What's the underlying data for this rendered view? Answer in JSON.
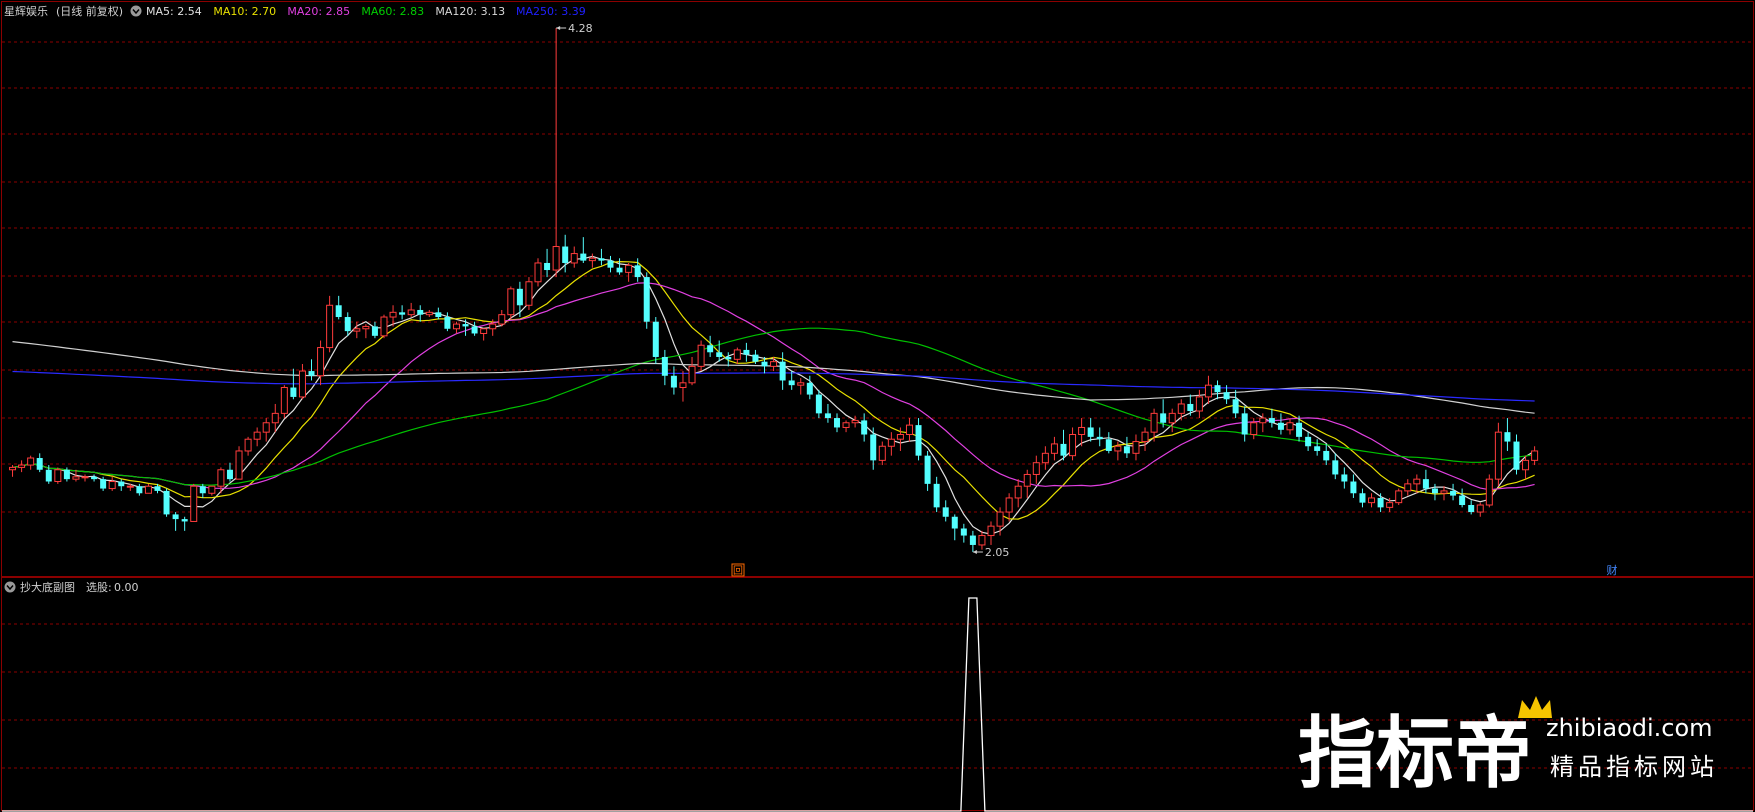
{
  "main_panel": {
    "stock_name": "星辉娱乐",
    "period_label": "(日线 前复权)",
    "ma_legend": [
      {
        "label": "MA5:",
        "value": "2.54",
        "color": "#e0e0e0"
      },
      {
        "label": "MA10:",
        "value": "2.70",
        "color": "#e8e000"
      },
      {
        "label": "MA20:",
        "value": "2.85",
        "color": "#e040e0"
      },
      {
        "label": "MA60:",
        "value": "2.83",
        "color": "#00d000"
      },
      {
        "label": "MA120:",
        "value": "3.13",
        "color": "#d8d8d8"
      },
      {
        "label": "MA250:",
        "value": "3.39",
        "color": "#2020ff"
      }
    ],
    "high_marker": "4.28",
    "low_marker": "2.05",
    "event_markers": [
      {
        "icon": "回",
        "color": "#ff6a00"
      },
      {
        "icon": "财",
        "color": "#4488ff"
      }
    ]
  },
  "sub_panel": {
    "title": "抄大底副图",
    "field_label": "选股:",
    "field_value": "0.00"
  },
  "watermark": {
    "brand": "指标帝",
    "domain": "zhibiaodi.com",
    "slogan": "精品指标网站"
  },
  "colors": {
    "up_candle": "#ff3c3c",
    "down_candle": "#54ffff",
    "grid": "#8b0000",
    "signal_line": "#ffffff"
  },
  "chart_data": [
    {
      "type": "candlestick",
      "price_range": [
        2.05,
        4.28
      ],
      "candles": [
        [
          2.4,
          2.42,
          2.37,
          2.41
        ],
        [
          2.41,
          2.44,
          2.39,
          2.42
        ],
        [
          2.42,
          2.46,
          2.4,
          2.45
        ],
        [
          2.45,
          2.47,
          2.39,
          2.4
        ],
        [
          2.4,
          2.42,
          2.34,
          2.35
        ],
        [
          2.35,
          2.41,
          2.34,
          2.4
        ],
        [
          2.4,
          2.41,
          2.35,
          2.36
        ],
        [
          2.36,
          2.4,
          2.35,
          2.37
        ],
        [
          2.37,
          2.38,
          2.35,
          2.37
        ],
        [
          2.37,
          2.38,
          2.35,
          2.36
        ],
        [
          2.36,
          2.37,
          2.31,
          2.32
        ],
        [
          2.32,
          2.37,
          2.31,
          2.35
        ],
        [
          2.35,
          2.36,
          2.31,
          2.33
        ],
        [
          2.33,
          2.34,
          2.31,
          2.33
        ],
        [
          2.33,
          2.34,
          2.29,
          2.3
        ],
        [
          2.3,
          2.34,
          2.3,
          2.33
        ],
        [
          2.33,
          2.34,
          2.3,
          2.31
        ],
        [
          2.31,
          2.32,
          2.2,
          2.21
        ],
        [
          2.21,
          2.22,
          2.14,
          2.19
        ],
        [
          2.19,
          2.2,
          2.14,
          2.18
        ],
        [
          2.18,
          2.34,
          2.18,
          2.33
        ],
        [
          2.33,
          2.34,
          2.28,
          2.3
        ],
        [
          2.3,
          2.33,
          2.29,
          2.33
        ],
        [
          2.33,
          2.41,
          2.3,
          2.4
        ],
        [
          2.4,
          2.43,
          2.35,
          2.36
        ],
        [
          2.36,
          2.5,
          2.36,
          2.48
        ],
        [
          2.48,
          2.54,
          2.46,
          2.53
        ],
        [
          2.53,
          2.58,
          2.5,
          2.56
        ],
        [
          2.56,
          2.62,
          2.52,
          2.6
        ],
        [
          2.6,
          2.68,
          2.56,
          2.64
        ],
        [
          2.64,
          2.76,
          2.62,
          2.75
        ],
        [
          2.75,
          2.83,
          2.7,
          2.71
        ],
        [
          2.71,
          2.85,
          2.7,
          2.82
        ],
        [
          2.82,
          2.87,
          2.78,
          2.8
        ],
        [
          2.8,
          2.95,
          2.76,
          2.92
        ],
        [
          2.92,
          3.14,
          2.9,
          3.1
        ],
        [
          3.1,
          3.14,
          3.04,
          3.05
        ],
        [
          3.05,
          3.07,
          2.97,
          2.99
        ],
        [
          2.99,
          3.03,
          2.96,
          3.0
        ],
        [
          3.0,
          3.02,
          2.96,
          3.01
        ],
        [
          3.01,
          3.03,
          2.96,
          2.97
        ],
        [
          2.97,
          3.06,
          2.96,
          3.05
        ],
        [
          3.05,
          3.1,
          3.01,
          3.07
        ],
        [
          3.07,
          3.1,
          3.04,
          3.06
        ],
        [
          3.06,
          3.11,
          3.05,
          3.08
        ],
        [
          3.08,
          3.1,
          3.03,
          3.06
        ],
        [
          3.06,
          3.08,
          3.05,
          3.07
        ],
        [
          3.07,
          3.09,
          3.04,
          3.05
        ],
        [
          3.05,
          3.07,
          2.99,
          3.0
        ],
        [
          3.0,
          3.03,
          2.98,
          3.02
        ],
        [
          3.02,
          3.04,
          2.97,
          3.01
        ],
        [
          3.01,
          3.03,
          2.97,
          2.98
        ],
        [
          2.98,
          3.0,
          2.95,
          3.0
        ],
        [
          3.0,
          3.04,
          2.97,
          3.02
        ],
        [
          3.02,
          3.08,
          3.01,
          3.06
        ],
        [
          3.06,
          3.18,
          3.04,
          3.17
        ],
        [
          3.17,
          3.2,
          3.05,
          3.1
        ],
        [
          3.1,
          3.22,
          3.08,
          3.2
        ],
        [
          3.2,
          3.3,
          3.18,
          3.28
        ],
        [
          3.28,
          3.34,
          3.22,
          3.25
        ],
        [
          3.25,
          4.28,
          3.22,
          3.35
        ],
        [
          3.35,
          3.4,
          3.24,
          3.28
        ],
        [
          3.28,
          3.35,
          3.26,
          3.32
        ],
        [
          3.32,
          3.39,
          3.28,
          3.29
        ],
        [
          3.29,
          3.32,
          3.26,
          3.3
        ],
        [
          3.3,
          3.34,
          3.27,
          3.29
        ],
        [
          3.29,
          3.31,
          3.24,
          3.26
        ],
        [
          3.26,
          3.3,
          3.23,
          3.24
        ],
        [
          3.24,
          3.28,
          3.2,
          3.27
        ],
        [
          3.27,
          3.3,
          3.2,
          3.22
        ],
        [
          3.22,
          3.24,
          3.0,
          3.03
        ],
        [
          3.03,
          3.05,
          2.85,
          2.88
        ],
        [
          2.88,
          2.91,
          2.76,
          2.8
        ],
        [
          2.8,
          2.84,
          2.72,
          2.75
        ],
        [
          2.75,
          2.82,
          2.69,
          2.77
        ],
        [
          2.77,
          2.88,
          2.76,
          2.84
        ],
        [
          2.84,
          2.95,
          2.82,
          2.93
        ],
        [
          2.93,
          2.97,
          2.88,
          2.9
        ],
        [
          2.9,
          2.95,
          2.86,
          2.88
        ],
        [
          2.88,
          2.9,
          2.84,
          2.87
        ],
        [
          2.87,
          2.92,
          2.85,
          2.91
        ],
        [
          2.91,
          2.94,
          2.86,
          2.89
        ],
        [
          2.89,
          2.91,
          2.85,
          2.86
        ],
        [
          2.86,
          2.88,
          2.81,
          2.84
        ],
        [
          2.84,
          2.88,
          2.82,
          2.86
        ],
        [
          2.86,
          2.9,
          2.74,
          2.78
        ],
        [
          2.78,
          2.82,
          2.74,
          2.76
        ],
        [
          2.76,
          2.79,
          2.72,
          2.77
        ],
        [
          2.77,
          2.8,
          2.7,
          2.72
        ],
        [
          2.72,
          2.74,
          2.62,
          2.64
        ],
        [
          2.64,
          2.68,
          2.6,
          2.62
        ],
        [
          2.62,
          2.64,
          2.56,
          2.58
        ],
        [
          2.58,
          2.61,
          2.56,
          2.6
        ],
        [
          2.6,
          2.63,
          2.58,
          2.61
        ],
        [
          2.61,
          2.64,
          2.52,
          2.55
        ],
        [
          2.55,
          2.58,
          2.4,
          2.44
        ],
        [
          2.44,
          2.52,
          2.42,
          2.5
        ],
        [
          2.5,
          2.56,
          2.46,
          2.53
        ],
        [
          2.53,
          2.58,
          2.48,
          2.55
        ],
        [
          2.55,
          2.62,
          2.52,
          2.59
        ],
        [
          2.59,
          2.62,
          2.44,
          2.46
        ],
        [
          2.46,
          2.48,
          2.31,
          2.34
        ],
        [
          2.34,
          2.37,
          2.22,
          2.24
        ],
        [
          2.24,
          2.27,
          2.18,
          2.2
        ],
        [
          2.2,
          2.21,
          2.1,
          2.15
        ],
        [
          2.15,
          2.17,
          2.09,
          2.12
        ],
        [
          2.12,
          2.14,
          2.05,
          2.08
        ],
        [
          2.08,
          2.14,
          2.06,
          2.12
        ],
        [
          2.12,
          2.18,
          2.08,
          2.16
        ],
        [
          2.16,
          2.24,
          2.12,
          2.22
        ],
        [
          2.22,
          2.3,
          2.18,
          2.28
        ],
        [
          2.28,
          2.36,
          2.24,
          2.33
        ],
        [
          2.33,
          2.4,
          2.28,
          2.38
        ],
        [
          2.38,
          2.46,
          2.34,
          2.43
        ],
        [
          2.43,
          2.5,
          2.4,
          2.47
        ],
        [
          2.47,
          2.54,
          2.44,
          2.51
        ],
        [
          2.51,
          2.57,
          2.44,
          2.46
        ],
        [
          2.46,
          2.58,
          2.44,
          2.55
        ],
        [
          2.55,
          2.62,
          2.5,
          2.58
        ],
        [
          2.58,
          2.62,
          2.52,
          2.54
        ],
        [
          2.54,
          2.58,
          2.5,
          2.53
        ],
        [
          2.53,
          2.56,
          2.47,
          2.48
        ],
        [
          2.48,
          2.52,
          2.44,
          2.5
        ],
        [
          2.5,
          2.54,
          2.45,
          2.47
        ],
        [
          2.47,
          2.55,
          2.44,
          2.52
        ],
        [
          2.52,
          2.58,
          2.48,
          2.56
        ],
        [
          2.56,
          2.66,
          2.52,
          2.64
        ],
        [
          2.64,
          2.7,
          2.58,
          2.6
        ],
        [
          2.6,
          2.66,
          2.56,
          2.64
        ],
        [
          2.64,
          2.7,
          2.61,
          2.68
        ],
        [
          2.68,
          2.72,
          2.63,
          2.65
        ],
        [
          2.65,
          2.74,
          2.62,
          2.71
        ],
        [
          2.71,
          2.8,
          2.68,
          2.76
        ],
        [
          2.76,
          2.78,
          2.7,
          2.73
        ],
        [
          2.73,
          2.76,
          2.68,
          2.7
        ],
        [
          2.7,
          2.74,
          2.62,
          2.64
        ],
        [
          2.64,
          2.67,
          2.52,
          2.55
        ],
        [
          2.55,
          2.62,
          2.53,
          2.6
        ],
        [
          2.6,
          2.64,
          2.56,
          2.62
        ],
        [
          2.62,
          2.66,
          2.58,
          2.6
        ],
        [
          2.6,
          2.64,
          2.55,
          2.57
        ],
        [
          2.57,
          2.62,
          2.55,
          2.6
        ],
        [
          2.6,
          2.63,
          2.52,
          2.54
        ],
        [
          2.54,
          2.56,
          2.48,
          2.5
        ],
        [
          2.5,
          2.53,
          2.46,
          2.48
        ],
        [
          2.48,
          2.51,
          2.42,
          2.44
        ],
        [
          2.44,
          2.47,
          2.36,
          2.38
        ],
        [
          2.38,
          2.41,
          2.32,
          2.35
        ],
        [
          2.35,
          2.38,
          2.28,
          2.3
        ],
        [
          2.3,
          2.32,
          2.24,
          2.26
        ],
        [
          2.26,
          2.3,
          2.24,
          2.28
        ],
        [
          2.28,
          2.3,
          2.22,
          2.24
        ],
        [
          2.24,
          2.28,
          2.22,
          2.26
        ],
        [
          2.26,
          2.32,
          2.25,
          2.31
        ],
        [
          2.31,
          2.36,
          2.29,
          2.34
        ],
        [
          2.34,
          2.38,
          2.3,
          2.36
        ],
        [
          2.36,
          2.4,
          2.3,
          2.32
        ],
        [
          2.32,
          2.34,
          2.27,
          2.3
        ],
        [
          2.3,
          2.33,
          2.27,
          2.31
        ],
        [
          2.31,
          2.34,
          2.27,
          2.29
        ],
        [
          2.29,
          2.32,
          2.24,
          2.25
        ],
        [
          2.25,
          2.27,
          2.21,
          2.22
        ],
        [
          2.22,
          2.26,
          2.2,
          2.25
        ],
        [
          2.25,
          2.38,
          2.24,
          2.36
        ],
        [
          2.36,
          2.6,
          2.33,
          2.56
        ],
        [
          2.56,
          2.62,
          2.48,
          2.52
        ],
        [
          2.52,
          2.55,
          2.38,
          2.4
        ],
        [
          2.4,
          2.46,
          2.36,
          2.44
        ],
        [
          2.44,
          2.5,
          2.42,
          2.48
        ]
      ]
    },
    {
      "type": "line",
      "name": "选股",
      "y_range": [
        0,
        1
      ],
      "values": "0.00 except 1.00 at index 106 (the day of the low 2.05)",
      "pulse_index": 106
    }
  ]
}
